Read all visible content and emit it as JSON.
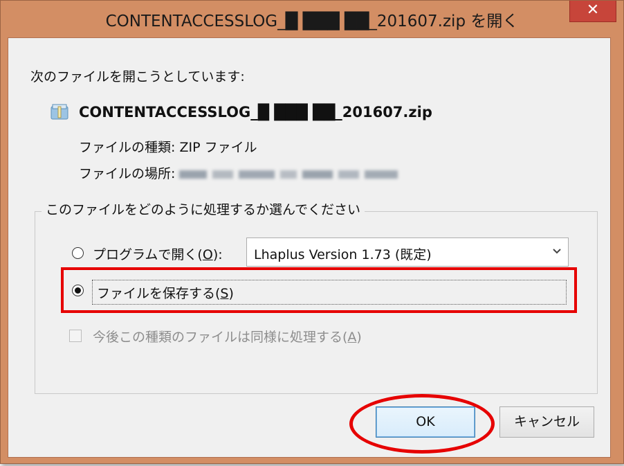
{
  "window": {
    "title": "CONTENTACCESSLOG_█ ███ ██_201607.zip を開く",
    "close_glyph": "✕"
  },
  "dialog": {
    "prompt": "次のファイルを開こうとしています:",
    "file_icon": "zip-file-icon",
    "file_name": "CONTENTACCESSLOG_█ ███ ██_201607.zip",
    "type_label": "ファイルの種類:",
    "type_value": "ZIP ファイル",
    "location_label": "ファイルの場所:",
    "group_title": "このファイルをどのように処理するか選んでください",
    "open_with_label_pre": "プログラムで開く(",
    "open_with_accel": "O",
    "open_with_label_post": "):",
    "open_with_selected": false,
    "program_value": "Lhaplus Version 1.73 (既定)",
    "save_label_pre": "ファイルを保存する(",
    "save_accel": "S",
    "save_label_post": ")",
    "save_selected": true,
    "remember_label_pre": "今後この種類のファイルは同様に処理する(",
    "remember_accel": "A",
    "remember_label_post": ")",
    "remember_checked": false,
    "remember_enabled": false,
    "ok_label": "OK",
    "cancel_label": "キャンセル"
  },
  "annotations": {
    "highlight_color": "#e60000"
  },
  "colors": {
    "frame": "#d38e64",
    "close_button": "#c7453a",
    "client_background": "#f0f0f0",
    "ok_border": "#3c7fb1"
  }
}
